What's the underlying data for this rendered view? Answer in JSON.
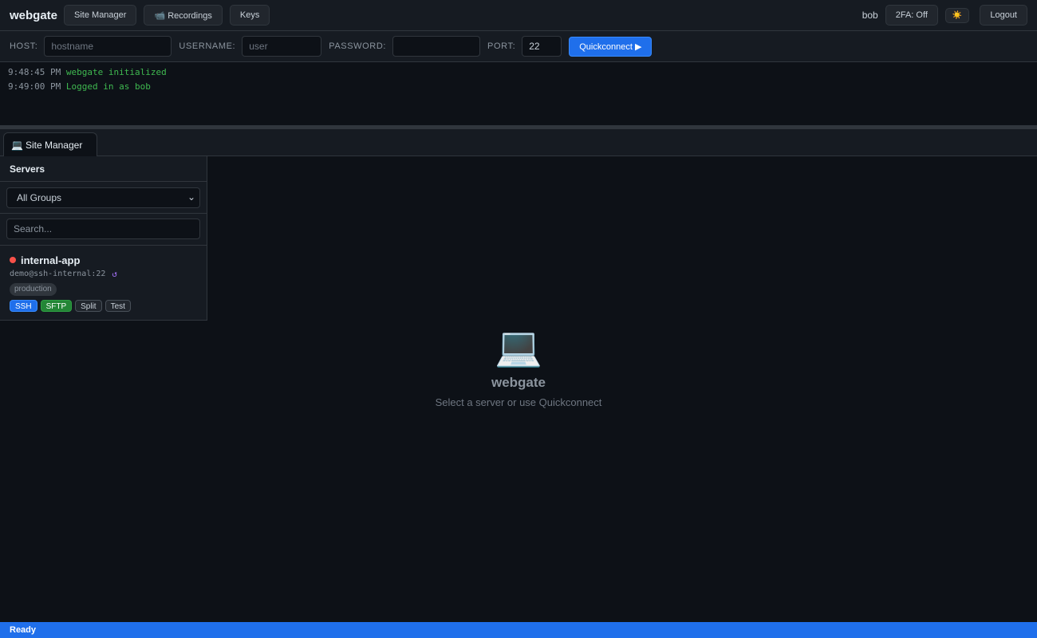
{
  "header": {
    "brand": "webgate",
    "nav": [
      "Site Manager",
      "📹 Recordings",
      "Keys"
    ],
    "user": "bob",
    "twofa": "2FA: Off",
    "theme_icon": "☀️",
    "logout": "Logout"
  },
  "quickconnect": {
    "host_label": "HOST:",
    "host_placeholder": "hostname",
    "username_label": "USERNAME:",
    "username_placeholder": "user",
    "password_label": "PASSWORD:",
    "port_label": "PORT:",
    "port_value": "22",
    "button": "Quickconnect ▶"
  },
  "log": [
    {
      "time": "9:48:45 PM",
      "message": "webgate initialized"
    },
    {
      "time": "9:49:00 PM",
      "message": "Logged in as bob"
    }
  ],
  "tabs": [
    {
      "icon": "💻",
      "label": "Site Manager"
    }
  ],
  "sidebar": {
    "title": "Servers",
    "group_select": "All Groups",
    "search_placeholder": "Search...",
    "servers": [
      {
        "name": "internal-app",
        "status_color": "#f85149",
        "address": "demo@ssh-internal:22",
        "reload_icon": "↺",
        "tag": "production",
        "actions": [
          "SSH",
          "SFTP",
          "Split",
          "Test"
        ]
      }
    ]
  },
  "welcome": {
    "icon": "💻",
    "title": "webgate",
    "subtitle": "Select a server or use Quickconnect"
  },
  "status": "Ready",
  "colors": {
    "accent": "#1f6feb",
    "success": "#238636",
    "offline": "#f85149",
    "background": "#0d1117"
  }
}
